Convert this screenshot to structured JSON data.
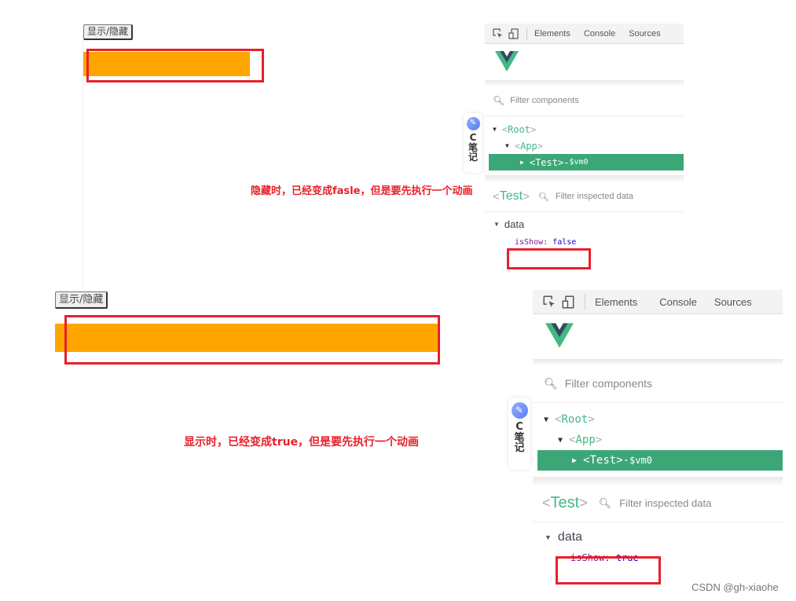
{
  "top_demo": {
    "button_label": "显示/隐藏",
    "annotation": "隐藏时，已经变成fasle，但是要先执行一个动画"
  },
  "bottom_demo": {
    "button_label": "显示/隐藏",
    "annotation": "显示时，已经变成true，但是要先执行一个动画"
  },
  "devtools_top": {
    "tabs": [
      "Elements",
      "Console",
      "Sources"
    ],
    "filter_components_placeholder": "Filter components",
    "tree": [
      {
        "name": "Root",
        "depth": 0,
        "expanded": true
      },
      {
        "name": "App",
        "depth": 1,
        "expanded": true
      },
      {
        "name": "Test",
        "depth": 2,
        "expanded": false,
        "selected": true,
        "vm": "$vm0"
      }
    ],
    "inspected_component": "Test",
    "filter_inspected_placeholder": "Filter inspected data",
    "data_section": "data",
    "data": [
      {
        "key": "isShow",
        "value": "false"
      }
    ],
    "cnote_label": "C\n笔\n记"
  },
  "devtools_bottom": {
    "tabs": [
      "Elements",
      "Console",
      "Sources"
    ],
    "filter_components_placeholder": "Filter components",
    "tree": [
      {
        "name": "Root",
        "depth": 0,
        "expanded": true
      },
      {
        "name": "App",
        "depth": 1,
        "expanded": true
      },
      {
        "name": "Test",
        "depth": 2,
        "expanded": false,
        "selected": true,
        "vm": "$vm0"
      }
    ],
    "inspected_component": "Test",
    "filter_inspected_placeholder": "Filter inspected data",
    "data_section": "data",
    "data": [
      {
        "key": "isShow",
        "value": "true"
      }
    ],
    "cnote_label": "C\n笔\n记"
  },
  "labels": {
    "separator": " - ",
    "colon": ": ",
    "lt": "<",
    "gt": ">",
    "cnote_c": "C",
    "cnote_bi": "笔",
    "cnote_ji": "记"
  },
  "colors": {
    "orange": "#ffa500",
    "highlight_red": "#e8202a",
    "vue_green": "#42b983",
    "selected_row": "#3ba776"
  },
  "watermark": "CSDN @gh-xiaohe"
}
